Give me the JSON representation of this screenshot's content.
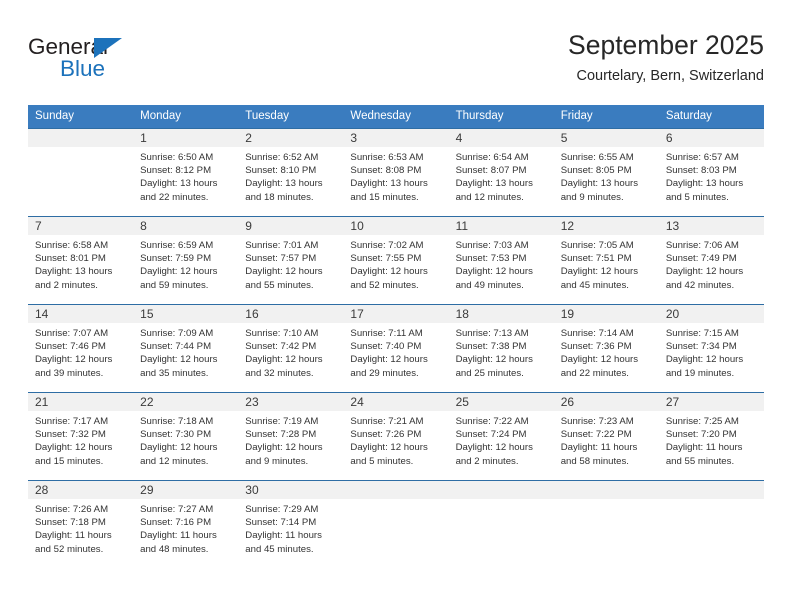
{
  "brand": {
    "name_top": "General",
    "name_bottom": "Blue",
    "accent_color": "#1c72bb",
    "triangle_icon": "triangle-icon"
  },
  "header": {
    "title": "September 2025",
    "subtitle": "Courtelary, Bern, Switzerland"
  },
  "calendar": {
    "header_bg": "#3a7cbf",
    "daynum_bg": "#f1f1f1",
    "separator_color": "#2e6da4",
    "weekday_headers": [
      "Sunday",
      "Monday",
      "Tuesday",
      "Wednesday",
      "Thursday",
      "Friday",
      "Saturday"
    ],
    "weeks": [
      [
        {
          "day": "",
          "sunrise": "",
          "sunset": "",
          "daylight_l1": "",
          "daylight_l2": ""
        },
        {
          "day": "1",
          "sunrise": "Sunrise: 6:50 AM",
          "sunset": "Sunset: 8:12 PM",
          "daylight_l1": "Daylight: 13 hours",
          "daylight_l2": "and 22 minutes."
        },
        {
          "day": "2",
          "sunrise": "Sunrise: 6:52 AM",
          "sunset": "Sunset: 8:10 PM",
          "daylight_l1": "Daylight: 13 hours",
          "daylight_l2": "and 18 minutes."
        },
        {
          "day": "3",
          "sunrise": "Sunrise: 6:53 AM",
          "sunset": "Sunset: 8:08 PM",
          "daylight_l1": "Daylight: 13 hours",
          "daylight_l2": "and 15 minutes."
        },
        {
          "day": "4",
          "sunrise": "Sunrise: 6:54 AM",
          "sunset": "Sunset: 8:07 PM",
          "daylight_l1": "Daylight: 13 hours",
          "daylight_l2": "and 12 minutes."
        },
        {
          "day": "5",
          "sunrise": "Sunrise: 6:55 AM",
          "sunset": "Sunset: 8:05 PM",
          "daylight_l1": "Daylight: 13 hours",
          "daylight_l2": "and 9 minutes."
        },
        {
          "day": "6",
          "sunrise": "Sunrise: 6:57 AM",
          "sunset": "Sunset: 8:03 PM",
          "daylight_l1": "Daylight: 13 hours",
          "daylight_l2": "and 5 minutes."
        }
      ],
      [
        {
          "day": "7",
          "sunrise": "Sunrise: 6:58 AM",
          "sunset": "Sunset: 8:01 PM",
          "daylight_l1": "Daylight: 13 hours",
          "daylight_l2": "and 2 minutes."
        },
        {
          "day": "8",
          "sunrise": "Sunrise: 6:59 AM",
          "sunset": "Sunset: 7:59 PM",
          "daylight_l1": "Daylight: 12 hours",
          "daylight_l2": "and 59 minutes."
        },
        {
          "day": "9",
          "sunrise": "Sunrise: 7:01 AM",
          "sunset": "Sunset: 7:57 PM",
          "daylight_l1": "Daylight: 12 hours",
          "daylight_l2": "and 55 minutes."
        },
        {
          "day": "10",
          "sunrise": "Sunrise: 7:02 AM",
          "sunset": "Sunset: 7:55 PM",
          "daylight_l1": "Daylight: 12 hours",
          "daylight_l2": "and 52 minutes."
        },
        {
          "day": "11",
          "sunrise": "Sunrise: 7:03 AM",
          "sunset": "Sunset: 7:53 PM",
          "daylight_l1": "Daylight: 12 hours",
          "daylight_l2": "and 49 minutes."
        },
        {
          "day": "12",
          "sunrise": "Sunrise: 7:05 AM",
          "sunset": "Sunset: 7:51 PM",
          "daylight_l1": "Daylight: 12 hours",
          "daylight_l2": "and 45 minutes."
        },
        {
          "day": "13",
          "sunrise": "Sunrise: 7:06 AM",
          "sunset": "Sunset: 7:49 PM",
          "daylight_l1": "Daylight: 12 hours",
          "daylight_l2": "and 42 minutes."
        }
      ],
      [
        {
          "day": "14",
          "sunrise": "Sunrise: 7:07 AM",
          "sunset": "Sunset: 7:46 PM",
          "daylight_l1": "Daylight: 12 hours",
          "daylight_l2": "and 39 minutes."
        },
        {
          "day": "15",
          "sunrise": "Sunrise: 7:09 AM",
          "sunset": "Sunset: 7:44 PM",
          "daylight_l1": "Daylight: 12 hours",
          "daylight_l2": "and 35 minutes."
        },
        {
          "day": "16",
          "sunrise": "Sunrise: 7:10 AM",
          "sunset": "Sunset: 7:42 PM",
          "daylight_l1": "Daylight: 12 hours",
          "daylight_l2": "and 32 minutes."
        },
        {
          "day": "17",
          "sunrise": "Sunrise: 7:11 AM",
          "sunset": "Sunset: 7:40 PM",
          "daylight_l1": "Daylight: 12 hours",
          "daylight_l2": "and 29 minutes."
        },
        {
          "day": "18",
          "sunrise": "Sunrise: 7:13 AM",
          "sunset": "Sunset: 7:38 PM",
          "daylight_l1": "Daylight: 12 hours",
          "daylight_l2": "and 25 minutes."
        },
        {
          "day": "19",
          "sunrise": "Sunrise: 7:14 AM",
          "sunset": "Sunset: 7:36 PM",
          "daylight_l1": "Daylight: 12 hours",
          "daylight_l2": "and 22 minutes."
        },
        {
          "day": "20",
          "sunrise": "Sunrise: 7:15 AM",
          "sunset": "Sunset: 7:34 PM",
          "daylight_l1": "Daylight: 12 hours",
          "daylight_l2": "and 19 minutes."
        }
      ],
      [
        {
          "day": "21",
          "sunrise": "Sunrise: 7:17 AM",
          "sunset": "Sunset: 7:32 PM",
          "daylight_l1": "Daylight: 12 hours",
          "daylight_l2": "and 15 minutes."
        },
        {
          "day": "22",
          "sunrise": "Sunrise: 7:18 AM",
          "sunset": "Sunset: 7:30 PM",
          "daylight_l1": "Daylight: 12 hours",
          "daylight_l2": "and 12 minutes."
        },
        {
          "day": "23",
          "sunrise": "Sunrise: 7:19 AM",
          "sunset": "Sunset: 7:28 PM",
          "daylight_l1": "Daylight: 12 hours",
          "daylight_l2": "and 9 minutes."
        },
        {
          "day": "24",
          "sunrise": "Sunrise: 7:21 AM",
          "sunset": "Sunset: 7:26 PM",
          "daylight_l1": "Daylight: 12 hours",
          "daylight_l2": "and 5 minutes."
        },
        {
          "day": "25",
          "sunrise": "Sunrise: 7:22 AM",
          "sunset": "Sunset: 7:24 PM",
          "daylight_l1": "Daylight: 12 hours",
          "daylight_l2": "and 2 minutes."
        },
        {
          "day": "26",
          "sunrise": "Sunrise: 7:23 AM",
          "sunset": "Sunset: 7:22 PM",
          "daylight_l1": "Daylight: 11 hours",
          "daylight_l2": "and 58 minutes."
        },
        {
          "day": "27",
          "sunrise": "Sunrise: 7:25 AM",
          "sunset": "Sunset: 7:20 PM",
          "daylight_l1": "Daylight: 11 hours",
          "daylight_l2": "and 55 minutes."
        }
      ],
      [
        {
          "day": "28",
          "sunrise": "Sunrise: 7:26 AM",
          "sunset": "Sunset: 7:18 PM",
          "daylight_l1": "Daylight: 11 hours",
          "daylight_l2": "and 52 minutes."
        },
        {
          "day": "29",
          "sunrise": "Sunrise: 7:27 AM",
          "sunset": "Sunset: 7:16 PM",
          "daylight_l1": "Daylight: 11 hours",
          "daylight_l2": "and 48 minutes."
        },
        {
          "day": "30",
          "sunrise": "Sunrise: 7:29 AM",
          "sunset": "Sunset: 7:14 PM",
          "daylight_l1": "Daylight: 11 hours",
          "daylight_l2": "and 45 minutes."
        },
        {
          "day": "",
          "sunrise": "",
          "sunset": "",
          "daylight_l1": "",
          "daylight_l2": ""
        },
        {
          "day": "",
          "sunrise": "",
          "sunset": "",
          "daylight_l1": "",
          "daylight_l2": ""
        },
        {
          "day": "",
          "sunrise": "",
          "sunset": "",
          "daylight_l1": "",
          "daylight_l2": ""
        },
        {
          "day": "",
          "sunrise": "",
          "sunset": "",
          "daylight_l1": "",
          "daylight_l2": ""
        }
      ]
    ]
  }
}
